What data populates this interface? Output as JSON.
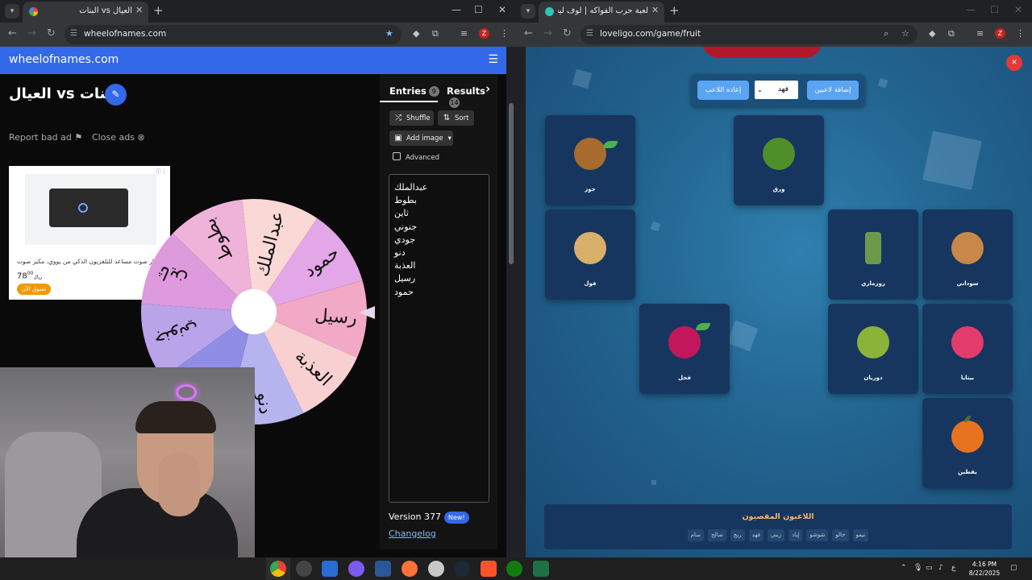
{
  "left_window": {
    "tab_title": "العيال vs البنات",
    "url": "wheelofnames.com",
    "profile_initial": "Z",
    "site": {
      "brand": "wheelofnames.com",
      "wheel_title": "البنات vs العيال",
      "report_bad_ad": "Report bad ad",
      "close_ads": "Close ads",
      "ad": {
        "text": "بار صوت مساعد للتلفزيون الذكي من يووي، مكبر صوت",
        "price_prefix": "ريال",
        "price": "78",
        "price_sup": "00",
        "cta": "تسوق الآن"
      },
      "tabs": {
        "entries_label": "Entries",
        "entries_count": "9",
        "results_label": "Results",
        "results_count": "14"
      },
      "buttons": {
        "shuffle": "Shuffle",
        "sort": "Sort",
        "add_image": "Add image",
        "advanced": "Advanced"
      },
      "entries": [
        "عبدالملك",
        "بطوط",
        "ثاين",
        "جنوني",
        "جودي",
        "دنو",
        "العذبة",
        "رسيل",
        "حمود"
      ],
      "wheel_segments": [
        {
          "label": "حمود",
          "color": "#e3a6e6"
        },
        {
          "label": "رسيل",
          "color": "#f1a9c5"
        },
        {
          "label": "العذبة",
          "color": "#f8d0d2"
        },
        {
          "label": "دنو",
          "color": "#b5b4ef"
        },
        {
          "label": "",
          "color": "#8f8ee4"
        },
        {
          "label": "جنوني",
          "color": "#b9a3e9"
        },
        {
          "label": "ثاين",
          "color": "#dd9add"
        },
        {
          "label": "بطوط",
          "color": "#efb2d9"
        },
        {
          "label": "عبدالملك",
          "color": "#f9d8d6"
        }
      ],
      "version": "Version 377",
      "new_badge": "New!",
      "changelog": "Changelog"
    }
  },
  "right_window": {
    "tab_title": "لعبة حرب الفواكه | لوف ليجو يوم",
    "url": "loveligo.com/game/fruit",
    "profile_initial": "Z",
    "game": {
      "add_players": "إضافة لاعبين",
      "selected_player": "فهد",
      "reset_player": "إعادة اللاعب",
      "cards": [
        {
          "label": "جوز",
          "color": "#a86a2e"
        },
        {
          "label": "ورق",
          "color": "#4f8f2a"
        },
        {
          "label": "فول",
          "color": "#d9b06a"
        },
        {
          "label": "روزماري",
          "color": "#6a9a4a"
        },
        {
          "label": "سوداني",
          "color": "#c8884a"
        },
        {
          "label": "فجل",
          "color": "#c2185b"
        },
        {
          "label": "دوريان",
          "color": "#8bb33a"
        },
        {
          "label": "بيتايا",
          "color": "#e23b6c"
        },
        {
          "label": "يقطين",
          "color": "#e8731e"
        }
      ],
      "eliminated_title": "اللاعبون المقصيون",
      "eliminated": [
        "نيمو",
        "خالو",
        "شوشو",
        "إياد",
        "زيني",
        "فهد",
        "ريج",
        "صالح",
        "سام"
      ]
    }
  },
  "taskbar": {
    "time": "4:16 PM",
    "date": "8/22/2025",
    "lang": "ع"
  }
}
